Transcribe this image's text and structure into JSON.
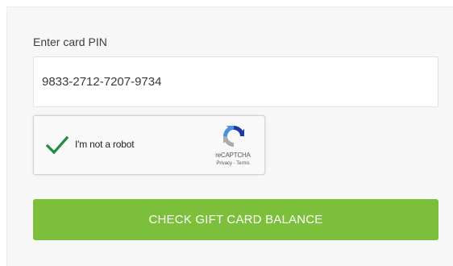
{
  "form": {
    "pin_label": "Enter card PIN",
    "pin_value": "9833-2712-7207-9734",
    "submit_label": "CHECK GIFT CARD BALANCE"
  },
  "recaptcha": {
    "checked": true,
    "label": "I'm not a robot",
    "brand": "reCAPTCHA",
    "privacy_link": "Privacy",
    "separator": " - ",
    "terms_link": "Terms",
    "check_icon": "green-checkmark",
    "logo_icon": "recaptcha-logo"
  },
  "colors": {
    "button_bg": "#7cbf3a",
    "check_green": "#1e8e3e",
    "logo_blue": "#1c3aa9",
    "logo_light_blue": "#4a90e2",
    "logo_gray": "#ababab"
  }
}
